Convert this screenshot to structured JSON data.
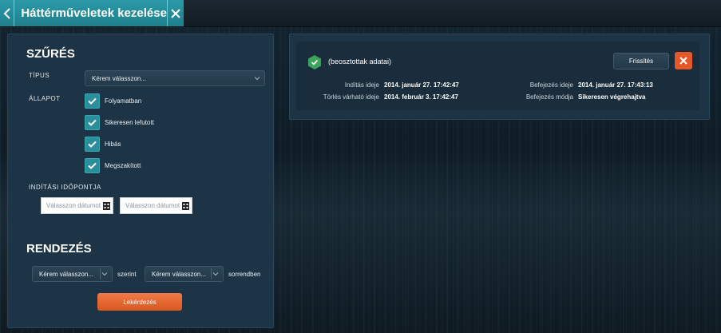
{
  "header": {
    "title": "Háttérműveletek kezelése"
  },
  "filter": {
    "heading": "SZŰRÉS",
    "type_label": "TÍPUS",
    "type_placeholder": "Kérem válasszon...",
    "status_label": "ÁLLAPOT",
    "statuses": [
      {
        "label": "Folyamatban",
        "checked": true
      },
      {
        "label": "Sikeresen lefutott",
        "checked": true
      },
      {
        "label": "Hibás",
        "checked": true
      },
      {
        "label": "Megszakított",
        "checked": true
      }
    ],
    "start_label": "INDÍTÁSI IDŐPONTJA",
    "date_from_placeholder": "Válasszon dátumot",
    "date_to_placeholder": "Válasszon dátumot"
  },
  "sort": {
    "heading": "RENDEZÉS",
    "field_placeholder": "Kérem válasszon...",
    "by_text": "szerint",
    "order_placeholder": "Kérem válasszon...",
    "order_text": "sorrendben"
  },
  "query_button": "Lekérdezés",
  "job": {
    "status": "success",
    "name": "(beosztottak adatai)",
    "refresh_button": "Frissítés",
    "start_label": "Indítás ideje",
    "start_value": "2014. január 27. 17:42:47",
    "end_label": "Befejezés ideje",
    "end_value": "2014. január 27. 17:43:13",
    "delete_label": "Törlés várható ideje",
    "delete_value": "2014. február 3. 17:42:47",
    "end_mode_label": "Befejezés módja",
    "end_mode_value": "Sikeresen végrehajtva"
  },
  "colors": {
    "accent": "#2a9aa8",
    "action": "#e4572a",
    "panel": "#1d3446"
  }
}
